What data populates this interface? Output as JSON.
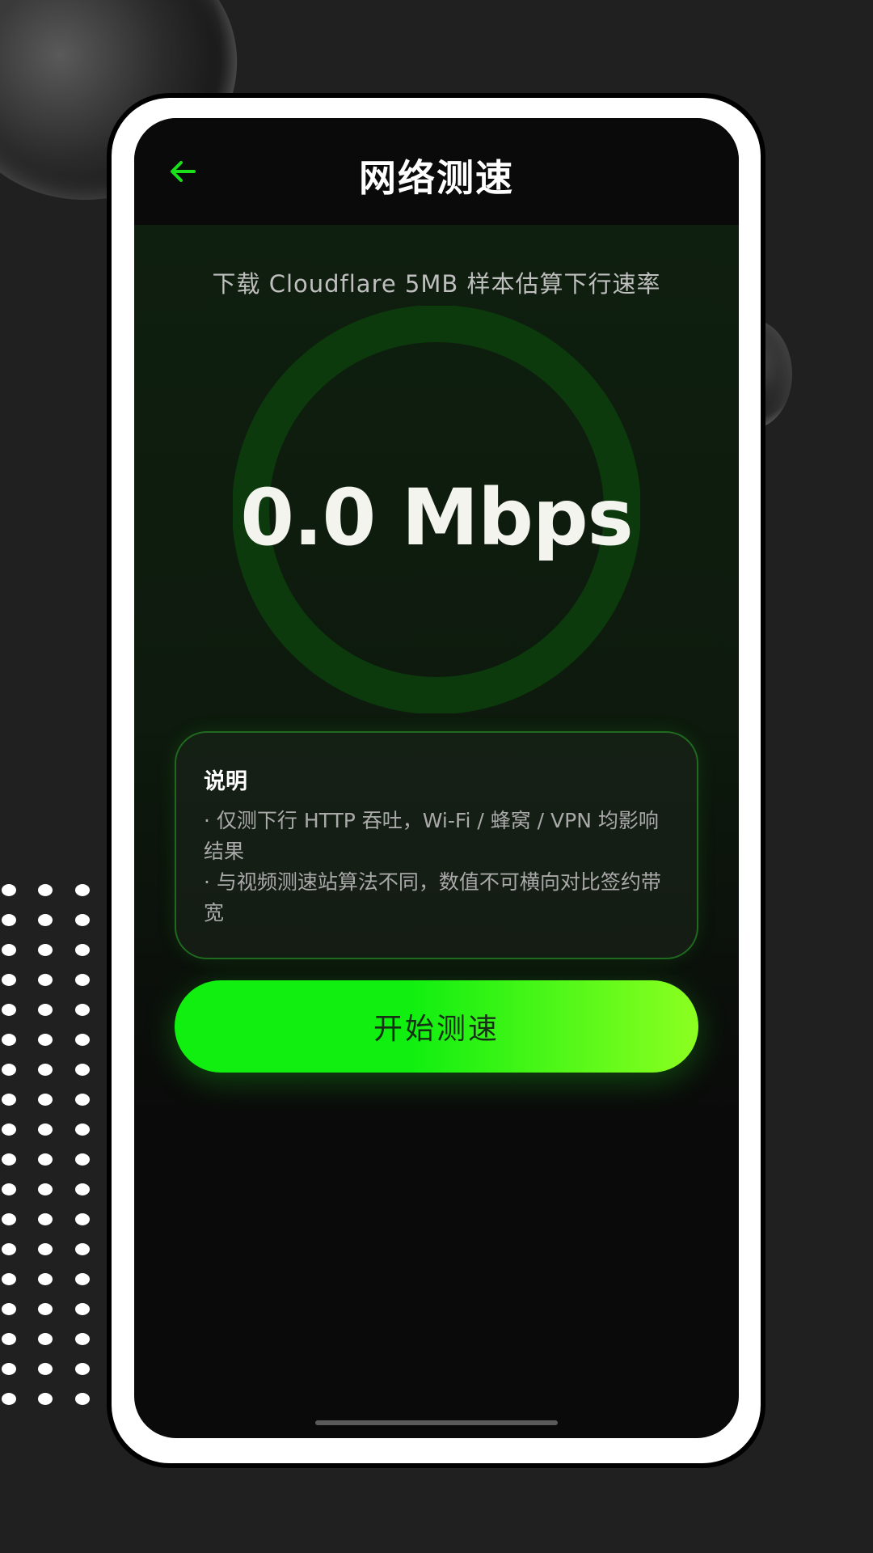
{
  "header": {
    "title": "网络测速",
    "back_icon": "arrow-left-icon"
  },
  "test": {
    "subtitle": "下载 Cloudflare 5MB 样本估算下行速率",
    "speed_display": "0.0 Mbps",
    "progress": 0
  },
  "info": {
    "title": "说明",
    "lines": [
      "· 仅测下行 HTTP 吞吐，Wi-Fi / 蜂窝 / VPN 均影响结果",
      "· 与视频测速站算法不同，数值不可横向对比签约带宽"
    ]
  },
  "actions": {
    "start_label": "开始测速"
  },
  "colors": {
    "accent": "#10ef10",
    "accent_end": "#8cff20",
    "gauge_ring": "#0c3a0c",
    "background": "#202020",
    "screen": "#0a0a0a"
  }
}
